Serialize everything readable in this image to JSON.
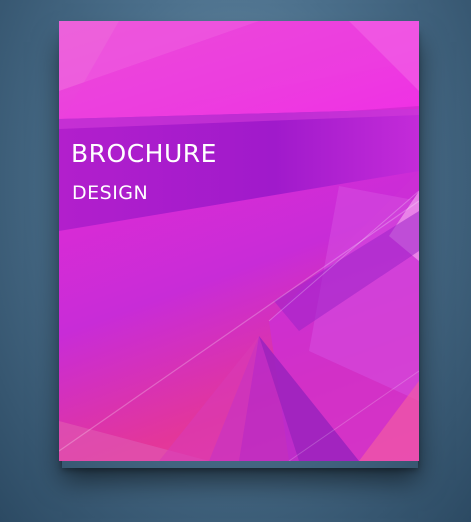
{
  "brochure": {
    "title": "BROCHURE",
    "subtitle": "DESIGN"
  },
  "colors": {
    "background": "#4b6f8b",
    "magenta": "#e43ad0",
    "purple": "#a81ccb",
    "pink": "#f0459e",
    "text": "#ffffff"
  }
}
